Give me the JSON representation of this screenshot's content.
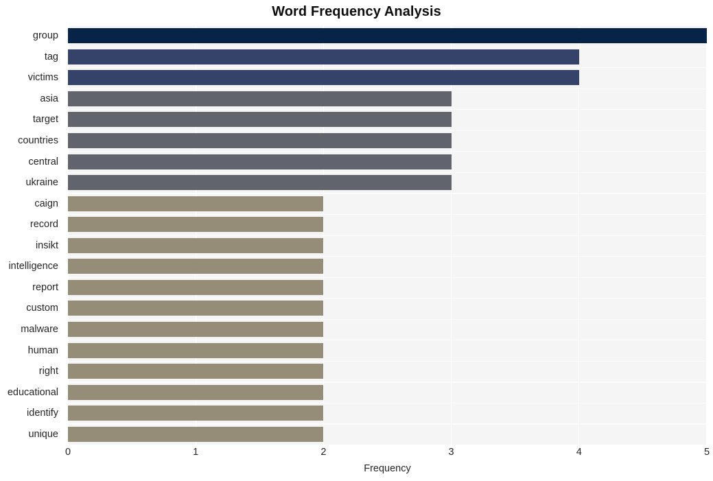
{
  "chart_data": {
    "type": "bar",
    "orientation": "horizontal",
    "title": "Word Frequency Analysis",
    "xlabel": "Frequency",
    "ylabel": "",
    "xlim": [
      0,
      5
    ],
    "xticks": [
      "0",
      "1",
      "2",
      "3",
      "4",
      "5"
    ],
    "grid": true,
    "legend": null,
    "categories": [
      "group",
      "tag",
      "victims",
      "asia",
      "target",
      "countries",
      "central",
      "ukraine",
      "caign",
      "record",
      "insikt",
      "intelligence",
      "report",
      "custom",
      "malware",
      "human",
      "right",
      "educational",
      "identify",
      "unique"
    ],
    "values": [
      5,
      4,
      4,
      3,
      3,
      3,
      3,
      3,
      2,
      2,
      2,
      2,
      2,
      2,
      2,
      2,
      2,
      2,
      2,
      2
    ],
    "bar_colors": [
      "#072448",
      "#35436b",
      "#35436b",
      "#62646d",
      "#62646d",
      "#62646d",
      "#62646d",
      "#62646d",
      "#968d78",
      "#968d78",
      "#968d78",
      "#968d78",
      "#968d78",
      "#968d78",
      "#968d78",
      "#968d78",
      "#968d78",
      "#968d78",
      "#968d78",
      "#968d78"
    ],
    "plot_background": "#f5f5f6",
    "figure_background": "#ffffff",
    "gridline_color": "#ffffff"
  }
}
